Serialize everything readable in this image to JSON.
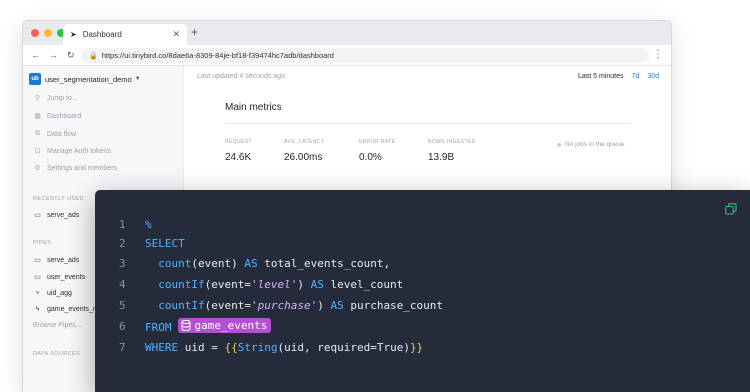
{
  "browser": {
    "tab_title": "Dashboard",
    "url": "https://ui.tinybird.co/8dae6a-8309-84je-bf18-f39474hc7adb/dashboard",
    "traffic_colors": [
      "#ff5f57",
      "#febc2e",
      "#28c840"
    ]
  },
  "sidebar": {
    "workspace_badge": "ub",
    "workspace": "user_segmentation_demo",
    "nav": [
      {
        "label": "Jump to...",
        "icon": "search-icon"
      },
      {
        "label": "Dashboard",
        "icon": "dashboard-icon"
      },
      {
        "label": "Data flow",
        "icon": "data-flow-icon"
      },
      {
        "label": "Manage Auth tokens",
        "icon": "lock-icon"
      },
      {
        "label": "Settings and members",
        "icon": "gear-icon"
      }
    ],
    "recently_used_title": "RECENTLY USED",
    "recently_used": [
      {
        "label": "serve_ads",
        "icon": "pipe-icon"
      }
    ],
    "pipes_title": "PIPES",
    "pipes": [
      {
        "label": "serve_ads",
        "icon": "pipe-icon"
      },
      {
        "label": "user_events",
        "icon": "pipe-icon"
      },
      {
        "label": "uid_agg",
        "icon": "materialized-icon"
      },
      {
        "label": "game_events_m",
        "icon": "bolt-icon"
      }
    ],
    "browse_pipes": "Browse Pipes...",
    "data_sources_title": "DATA SOURCES"
  },
  "main": {
    "last_updated": "Last updated 4 seconds ago",
    "ranges": {
      "active": "Last 5 minutes",
      "opt1": "7d",
      "opt2": "30d"
    },
    "card_title": "Main metrics",
    "metrics": [
      {
        "label": "REQUEST",
        "value": "24.6K"
      },
      {
        "label": "AVG. LATENCY",
        "value": "26.00ms"
      },
      {
        "label": "ERROR RATE",
        "value": "0.0%"
      },
      {
        "label": "ROWS INGESTED",
        "value": "13.9B"
      }
    ],
    "queue": "No jobs in the queue"
  },
  "code": {
    "line_numbers": [
      "1",
      "2",
      "3",
      "4",
      "5",
      "6",
      "7"
    ],
    "l1": "%",
    "l2_kw": "SELECT",
    "l3_fn": "count",
    "l3_open": "(event) ",
    "l3_as": "AS",
    "l3_rest": " total_events_count,",
    "l4_fn": "countIf",
    "l4_open": "(event=",
    "l4_str": "'level'",
    "l4_close": ") ",
    "l4_as": "AS",
    "l4_rest": " level_count",
    "l5_fn": "countIf",
    "l5_open": "(event=",
    "l5_str": "'purchase'",
    "l5_close": ") ",
    "l5_as": "AS",
    "l5_rest": " purchase_count",
    "l6_kw": "FROM",
    "l6_pill": "game_events",
    "l7_kw": "WHERE",
    "l7_mid": " uid = ",
    "l7_open": "{{",
    "l7_fn": "String",
    "l7_args": "(uid, required=True)",
    "l7_close": "}}",
    "colors": {
      "keyword": "#4fb3ff",
      "string": "#d6b3ff",
      "brace": "#e8cf4f",
      "pill": "#b44fd6",
      "copy": "#35c07a"
    }
  }
}
